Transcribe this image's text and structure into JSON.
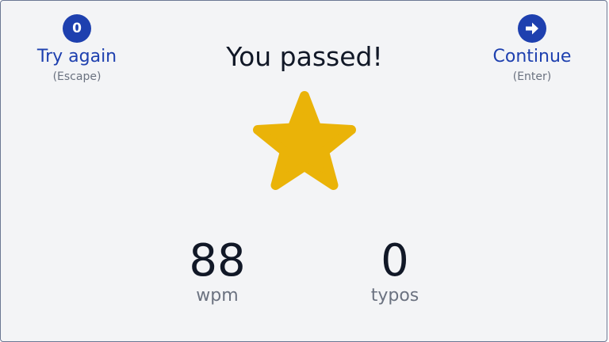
{
  "title": "You passed!",
  "actions": {
    "retry": {
      "icon_text": "0",
      "label": "Try again",
      "hint": "(Escape)"
    },
    "continue": {
      "icon": "arrow-right-icon",
      "label": "Continue",
      "hint": "(Enter)"
    }
  },
  "star": {
    "icon": "star-icon",
    "color": "#eab308"
  },
  "stats": {
    "wpm": {
      "value": "88",
      "label": "wpm"
    },
    "typos": {
      "value": "0",
      "label": "typos"
    }
  },
  "colors": {
    "accent": "#1e40af",
    "background": "#f3f4f6",
    "text": "#111827",
    "muted": "#6b7280"
  }
}
